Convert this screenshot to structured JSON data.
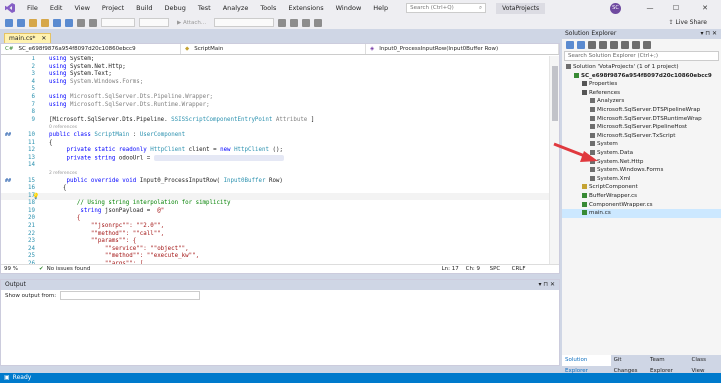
{
  "menu": [
    "File",
    "Edit",
    "View",
    "Project",
    "Build",
    "Debug",
    "Test",
    "Analyze",
    "Tools",
    "Extensions",
    "Window",
    "Help"
  ],
  "search": {
    "placeholder": "Search (Ctrl+Q)"
  },
  "project_title": "VotaProjects",
  "user_initials": "SC",
  "toolbar": {
    "attach_label": "Attach..."
  },
  "live_share": "Live Share",
  "editor": {
    "tab_label": "main.cs*",
    "nav": [
      "SC_e698f9876a954f8097d20c10860ebcc9",
      "ScriptMain",
      "Input0_ProcessInputRow(Input0Buffer Row)"
    ],
    "status": {
      "zoom": "99 %",
      "issues": "No issues found",
      "ln": "Ln: 17",
      "ch": "Ch: 9",
      "spc": "SPC",
      "crlf": "CRLF"
    }
  },
  "code_lines": [
    {
      "ln": "1",
      "tokens": [
        [
          "kw",
          "using"
        ],
        [
          "",
          "System;"
        ]
      ]
    },
    {
      "ln": "2",
      "tokens": [
        [
          "kw",
          "using"
        ],
        [
          "",
          "System.Net.Http;"
        ]
      ]
    },
    {
      "ln": "3",
      "tokens": [
        [
          "kw",
          "using"
        ],
        [
          "",
          "System.Text;"
        ]
      ]
    },
    {
      "ln": "4",
      "tokens": [
        [
          "kw",
          "using"
        ],
        [
          "gr",
          "System.Windows.Forms;"
        ]
      ]
    },
    {
      "ln": "5",
      "tokens": []
    },
    {
      "ln": "6",
      "tokens": [
        [
          "kw",
          "using"
        ],
        [
          "gr",
          "Microsoft.SqlServer.Dts.Pipeline.Wrapper;"
        ]
      ]
    },
    {
      "ln": "7",
      "tokens": [
        [
          "kw",
          "using"
        ],
        [
          "gr",
          "Microsoft.SqlServer.Dts.Runtime.Wrapper;"
        ]
      ]
    },
    {
      "ln": "8",
      "tokens": []
    },
    {
      "ln": "9",
      "tokens": [
        [
          "",
          "[Microsoft.SqlServer.Dts.Pipeline."
        ],
        [
          "ty",
          "SSISScriptComponentEntryPoint"
        ],
        [
          "gr",
          "Attribute"
        ],
        [
          "",
          "]"
        ]
      ]
    },
    {
      "hint": "0 references"
    },
    {
      "ln": "10",
      "mark": "##",
      "tokens": [
        [
          "kw",
          "public class"
        ],
        [
          "ty",
          "ScriptMain"
        ],
        [
          "",
          ":"
        ],
        [
          "ty",
          "UserComponent"
        ]
      ]
    },
    {
      "ln": "11",
      "tokens": [
        [
          "",
          "{"
        ]
      ]
    },
    {
      "ln": "12",
      "tokens": [
        [
          "",
          "    "
        ],
        [
          "kw",
          "private static readonly"
        ],
        [
          "ty",
          "HttpClient"
        ],
        [
          "",
          "client ="
        ],
        [
          "kw",
          "new"
        ],
        [
          "ty",
          "HttpClient"
        ],
        [
          "",
          "();"
        ]
      ]
    },
    {
      "ln": "13",
      "tokens": [
        [
          "",
          "    "
        ],
        [
          "kw",
          "private string"
        ],
        [
          "",
          "odooUrl ="
        ]
      ],
      "blur": true
    },
    {
      "ln": "14",
      "tokens": []
    },
    {
      "hint": "2 references"
    },
    {
      "ln": "15",
      "mark": "##",
      "tokens": [
        [
          "",
          "    "
        ],
        [
          "kw",
          "public override void"
        ],
        [
          "",
          "Input0_ProcessInputRow("
        ],
        [
          "ty",
          "Input0Buffer"
        ],
        [
          "",
          "Row)"
        ]
      ]
    },
    {
      "ln": "16",
      "tokens": [
        [
          "",
          "    {"
        ]
      ]
    },
    {
      "ln": "17",
      "bulb": true,
      "tokens": []
    },
    {
      "ln": "18",
      "tokens": [
        [
          "cm",
          "        // Using string interpolation for simplicity"
        ]
      ]
    },
    {
      "ln": "19",
      "tokens": [
        [
          "",
          "        "
        ],
        [
          "kw",
          "string"
        ],
        [
          "",
          "jsonPayload = "
        ],
        [
          "str",
          "@\""
        ]
      ]
    },
    {
      "ln": "20",
      "tokens": [
        [
          "str",
          "        {"
        ]
      ]
    },
    {
      "ln": "21",
      "tokens": [
        [
          "str",
          "            \"\"jsonrpc\"\": \"\"2.0\"\","
        ]
      ]
    },
    {
      "ln": "22",
      "tokens": [
        [
          "str",
          "            \"\"method\"\": \"\"call\"\","
        ]
      ]
    },
    {
      "ln": "23",
      "tokens": [
        [
          "str",
          "            \"\"params\"\": {"
        ]
      ]
    },
    {
      "ln": "24",
      "tokens": [
        [
          "str",
          "                \"\"service\"\": \"\"object\"\","
        ]
      ]
    },
    {
      "ln": "25",
      "tokens": [
        [
          "str",
          "                \"\"method\"\": \"\"execute_kw\"\","
        ]
      ]
    },
    {
      "ln": "26",
      "tokens": [
        [
          "str",
          "                \"\"args\"\": ["
        ]
      ]
    }
  ],
  "solution_explorer": {
    "title": "Solution Explorer",
    "search_placeholder": "Search Solution Explorer (Ctrl+;)",
    "items": [
      {
        "label": "Solution 'VotaProjects' (1 of 1 project)",
        "indent": 0,
        "icon": "#6e6e6e"
      },
      {
        "label": "SC_e698f9876a954f8097d20c10860ebcc9",
        "indent": 1,
        "icon": "#388a34",
        "bold": true
      },
      {
        "label": "Properties",
        "indent": 2,
        "icon": "#555"
      },
      {
        "label": "References",
        "indent": 2,
        "icon": "#555"
      },
      {
        "label": "Analyzers",
        "indent": 3,
        "icon": "#6e6e6e"
      },
      {
        "label": "Microsoft.SqlServer.DTSPipelineWrap",
        "indent": 3,
        "icon": "#6e6e6e"
      },
      {
        "label": "Microsoft.SqlServer.DTSRuntimeWrap",
        "indent": 3,
        "icon": "#6e6e6e"
      },
      {
        "label": "Microsoft.SqlServer.PipelineHost",
        "indent": 3,
        "icon": "#6e6e6e"
      },
      {
        "label": "Microsoft.SqlServer.TxScript",
        "indent": 3,
        "icon": "#6e6e6e"
      },
      {
        "label": "System",
        "indent": 3,
        "icon": "#6e6e6e"
      },
      {
        "label": "System.Data",
        "indent": 3,
        "icon": "#6e6e6e"
      },
      {
        "label": "System.Net.Http",
        "indent": 3,
        "icon": "#6e6e6e"
      },
      {
        "label": "System.Windows.Forms",
        "indent": 3,
        "icon": "#6e6e6e"
      },
      {
        "label": "System.Xml",
        "indent": 3,
        "icon": "#6e6e6e"
      },
      {
        "label": "ScriptComponent",
        "indent": 2,
        "icon": "#c5a332"
      },
      {
        "label": "BufferWrapper.cs",
        "indent": 2,
        "icon": "#388a34"
      },
      {
        "label": "ComponentWrapper.cs",
        "indent": 2,
        "icon": "#388a34"
      },
      {
        "label": "main.cs",
        "indent": 2,
        "icon": "#388a34",
        "selected": true
      }
    ],
    "tabs": [
      "Solution Explorer",
      "Git Changes",
      "Team Explorer",
      "Class View"
    ]
  },
  "output": {
    "title": "Output",
    "show_from_label": "Show output from:"
  },
  "statusbar": {
    "text": "Ready"
  },
  "colors": {
    "accent": "#007acc",
    "annotation_arrow": "#e0393e"
  }
}
